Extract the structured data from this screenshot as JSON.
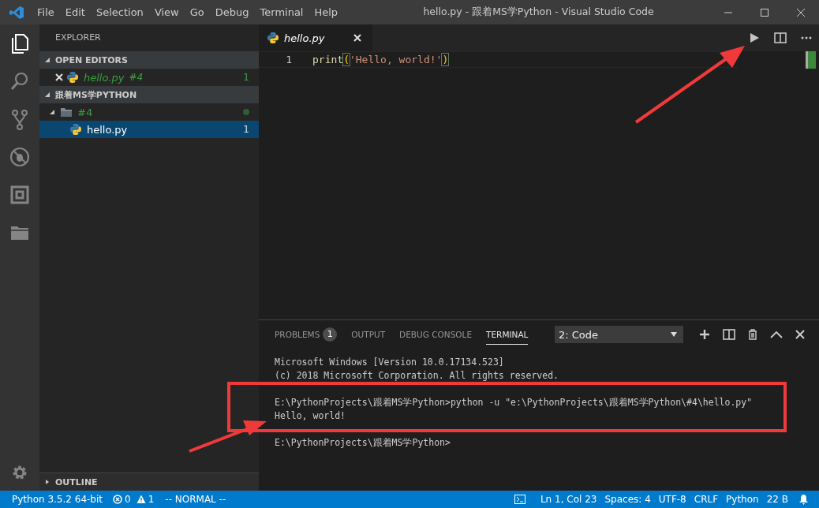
{
  "window": {
    "title": "hello.py - 跟着MS学Python - Visual Studio Code"
  },
  "menu": [
    {
      "label": "File"
    },
    {
      "label": "Edit"
    },
    {
      "label": "Selection"
    },
    {
      "label": "View"
    },
    {
      "label": "Go"
    },
    {
      "label": "Debug"
    },
    {
      "label": "Terminal"
    },
    {
      "label": "Help"
    }
  ],
  "activity_bar": [
    {
      "kind": "files",
      "selected": true
    },
    {
      "kind": "search",
      "selected": false
    },
    {
      "kind": "source-control",
      "selected": false
    },
    {
      "kind": "debug",
      "selected": false
    },
    {
      "kind": "extensions",
      "selected": false
    },
    {
      "kind": "folder",
      "selected": false
    }
  ],
  "sidebar": {
    "title": "EXPLORER",
    "open_editors": {
      "title": "OPEN EDITORS",
      "expanded": true,
      "items": [
        {
          "name": "hello.py",
          "description": "#4",
          "badge": "1",
          "preview": true
        }
      ]
    },
    "folder": {
      "title": "跟着MS学PYTHON",
      "expanded": true,
      "children": [
        {
          "kind": "folder",
          "name": "#4",
          "expanded": true,
          "modified": true,
          "selected": false,
          "children": [
            {
              "kind": "file",
              "name": "hello.py",
              "badge": "1",
              "selected": true
            }
          ]
        }
      ]
    },
    "outline": {
      "title": "OUTLINE",
      "expanded": false
    }
  },
  "editor": {
    "tabs": [
      {
        "label": "hello.py",
        "selected": true,
        "preview": true
      }
    ],
    "lines": [
      {
        "number": "1",
        "tokens": [
          {
            "kind": "function",
            "text": "print"
          },
          {
            "kind": "bracket",
            "text": "("
          },
          {
            "kind": "string",
            "text": "'Hello, world!'"
          },
          {
            "kind": "bracket",
            "text": ")"
          }
        ]
      }
    ]
  },
  "panel": {
    "tabs": [
      {
        "label": "PROBLEMS",
        "badge": "1",
        "selected": false
      },
      {
        "label": "OUTPUT",
        "selected": false
      },
      {
        "label": "DEBUG CONSOLE",
        "selected": false
      },
      {
        "label": "TERMINAL",
        "selected": true
      }
    ],
    "terminal_select": "2: Code",
    "terminal_blocks": [
      {
        "lines": [
          "Microsoft Windows [Version 10.0.17134.523]",
          "(c) 2018 Microsoft Corporation. All rights reserved."
        ]
      },
      {
        "lines": [
          "E:\\PythonProjects\\跟着MS学Python>python -u \"e:\\PythonProjects\\跟着MS学Python\\#4\\hello.py\"",
          "Hello, world!"
        ]
      },
      {
        "lines": [
          "E:\\PythonProjects\\跟着MS学Python>"
        ]
      }
    ]
  },
  "status_bar": {
    "interpreter": "Python 3.5.2 64-bit",
    "errors": "0",
    "warnings": "1",
    "mode": "-- NORMAL --",
    "right": [
      "Ln 1, Col 23",
      "Spaces: 4",
      "UTF-8",
      "CRLF",
      "Python",
      "22 B"
    ]
  }
}
